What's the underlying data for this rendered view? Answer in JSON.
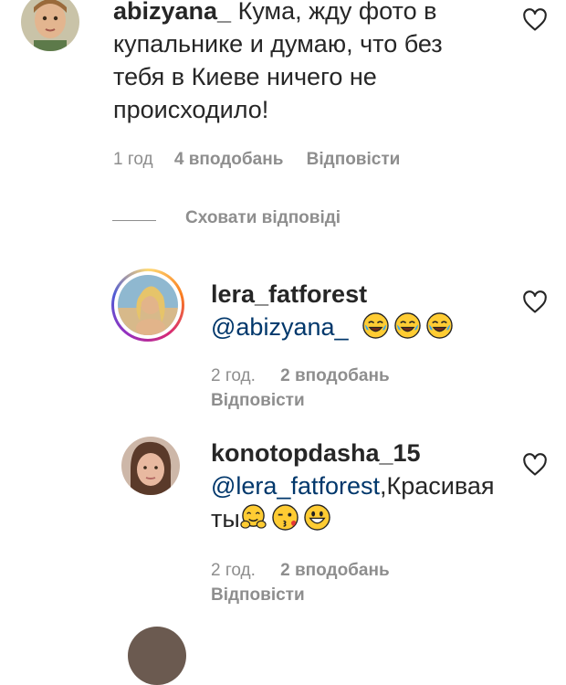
{
  "comments": [
    {
      "username": "abizyana_",
      "text": "Кума, жду фото в купальнике и думаю, что без тебя в Киеве ничего не происходило!",
      "time": "1 год",
      "likes": "4 вподобань",
      "reply": "Відповісти",
      "emoji": []
    },
    {
      "username": "lera_fatforest",
      "mention": "@abizyana_",
      "text": "",
      "emoji": [
        "joy-emoji",
        "joy-emoji",
        "joy-emoji"
      ],
      "time": "2 год.",
      "likes": "2 вподобань",
      "reply": "Відповісти"
    },
    {
      "username": "konotopdasha_15",
      "mention": "@lera_fatforest",
      "text": ",Красивая ты",
      "emoji": [
        "hugging-emoji",
        "kissing-wink-emoji",
        "grinning-emoji"
      ],
      "time": "2 год.",
      "likes": "2 вподобань",
      "reply": "Відповісти"
    }
  ],
  "replies_toggle": "Сховати відповіді",
  "colors": {
    "mention": "#00376b",
    "meta": "#8e8e8e",
    "text": "#262626"
  }
}
